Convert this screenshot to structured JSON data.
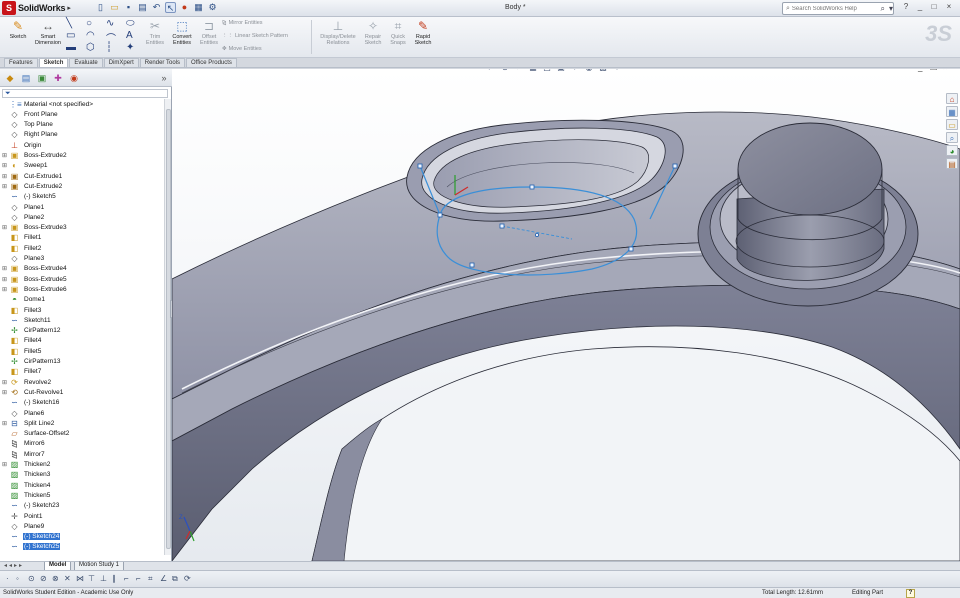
{
  "app": {
    "logo_text": "SolidWorks",
    "document_title": "Body *",
    "search_placeholder": "Search SolidWorks Help",
    "window_controls": [
      "?",
      "_",
      "□",
      "×"
    ]
  },
  "ribbon": {
    "sketch": "Sketch",
    "smart_dimension": "Smart Dimension",
    "trim_entities": "Trim Entities",
    "convert_entities": "Convert Entities",
    "offset_entities": "Offset Entities",
    "mirror_entities": "Mirror Entities",
    "linear_sketch_pattern": "Linear Sketch Pattern",
    "move_entities": "Move Entities",
    "display_delete_relations": "Display/Delete Relations",
    "repair_sketch": "Repair Sketch",
    "quick_snaps": "Quick Snaps",
    "rapid_sketch": "Rapid Sketch"
  },
  "command_tabs": [
    "Features",
    "Sketch",
    "Evaluate",
    "DimXpert",
    "Render Tools",
    "Office Products"
  ],
  "active_command_tab": "Sketch",
  "feature_tree": {
    "items": [
      {
        "label": "Material <not specified>",
        "icon": "material-icon",
        "expand": false
      },
      {
        "label": "Front Plane",
        "icon": "plane-icon",
        "expand": false
      },
      {
        "label": "Top Plane",
        "icon": "plane-icon",
        "expand": false
      },
      {
        "label": "Right Plane",
        "icon": "plane-icon",
        "expand": false
      },
      {
        "label": "Origin",
        "icon": "origin-icon",
        "expand": false
      },
      {
        "label": "Boss-Extrude2",
        "icon": "boss-extrude-icon",
        "expand": true
      },
      {
        "label": "Sweep1",
        "icon": "sweep-icon",
        "expand": true
      },
      {
        "label": "Cut-Extrude1",
        "icon": "cut-extrude-icon",
        "expand": true
      },
      {
        "label": "Cut-Extrude2",
        "icon": "cut-extrude-icon",
        "expand": true
      },
      {
        "label": "(-) Sketch5",
        "icon": "sketch-icon",
        "expand": false
      },
      {
        "label": "Plane1",
        "icon": "plane-icon",
        "expand": false
      },
      {
        "label": "Plane2",
        "icon": "plane-icon",
        "expand": false
      },
      {
        "label": "Boss-Extrude3",
        "icon": "boss-extrude-icon",
        "expand": true
      },
      {
        "label": "Fillet1",
        "icon": "fillet-icon",
        "expand": false
      },
      {
        "label": "Fillet2",
        "icon": "fillet-icon",
        "expand": false
      },
      {
        "label": "Plane3",
        "icon": "plane-icon",
        "expand": false
      },
      {
        "label": "Boss-Extrude4",
        "icon": "boss-extrude-icon",
        "expand": true
      },
      {
        "label": "Boss-Extrude5",
        "icon": "boss-extrude-icon",
        "expand": true
      },
      {
        "label": "Boss-Extrude6",
        "icon": "boss-extrude-icon",
        "expand": true
      },
      {
        "label": "Dome1",
        "icon": "dome-icon",
        "expand": false
      },
      {
        "label": "Fillet3",
        "icon": "fillet-icon",
        "expand": false
      },
      {
        "label": "Sketch11",
        "icon": "sketch-icon",
        "expand": false
      },
      {
        "label": "CirPattern12",
        "icon": "circular-pattern-icon",
        "expand": false
      },
      {
        "label": "Fillet4",
        "icon": "fillet-icon",
        "expand": false
      },
      {
        "label": "Fillet5",
        "icon": "fillet-icon",
        "expand": false
      },
      {
        "label": "CirPattern13",
        "icon": "circular-pattern-icon",
        "expand": false
      },
      {
        "label": "Fillet7",
        "icon": "fillet-icon",
        "expand": false
      },
      {
        "label": "Revolve2",
        "icon": "revolve-icon",
        "expand": true
      },
      {
        "label": "Cut-Revolve1",
        "icon": "cut-revolve-icon",
        "expand": true
      },
      {
        "label": "(-) Sketch16",
        "icon": "sketch-icon",
        "expand": false
      },
      {
        "label": "Plane6",
        "icon": "plane-icon",
        "expand": false
      },
      {
        "label": "Split Line2",
        "icon": "split-line-icon",
        "expand": true
      },
      {
        "label": "Surface-Offset2",
        "icon": "surface-offset-icon",
        "expand": false
      },
      {
        "label": "Mirror6",
        "icon": "mirror-icon",
        "expand": false
      },
      {
        "label": "Mirror7",
        "icon": "mirror-icon",
        "expand": false
      },
      {
        "label": "Thicken2",
        "icon": "thicken-icon",
        "expand": true
      },
      {
        "label": "Thicken3",
        "icon": "thicken-icon",
        "expand": false
      },
      {
        "label": "Thicken4",
        "icon": "thicken-icon",
        "expand": false
      },
      {
        "label": "Thicken5",
        "icon": "thicken-icon",
        "expand": false
      },
      {
        "label": "(-) Sketch23",
        "icon": "sketch-icon",
        "expand": false
      },
      {
        "label": "Point1",
        "icon": "point-icon",
        "expand": false
      },
      {
        "label": "Plane9",
        "icon": "plane-icon",
        "expand": false
      },
      {
        "label": "(-) Sketch24",
        "icon": "sketch-icon",
        "expand": false,
        "selected": true
      },
      {
        "label": "(-) Sketch25",
        "icon": "sketch-icon",
        "expand": false,
        "selected": true
      }
    ]
  },
  "model_tabs": [
    "Model",
    "Motion Study 1"
  ],
  "active_model_tab": "Model",
  "status": {
    "edition": "SolidWorks Student Edition - Academic Use Only",
    "total_length": "Total Length: 12.61mm",
    "mode": "Editing Part",
    "help": "?"
  },
  "colors": {
    "accent": "#3173cf",
    "sketch_line": "#3a8fd8",
    "model_gray": "#8c8fa3",
    "model_dark": "#5e6175",
    "background_top": "#ffffff"
  }
}
